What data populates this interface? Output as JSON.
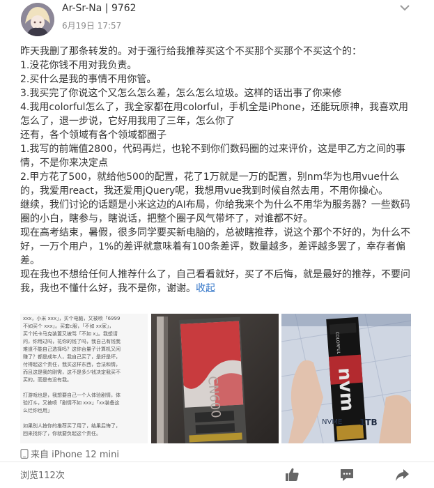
{
  "post": {
    "author": "Ar-Sr-Na | 9762",
    "time": "6月19日 17:57",
    "paragraphs": [
      "昨天我删了那条转发的。对于强行给我推荐买这个不买那个买那个不买这个的：",
      "1.没花你钱不用对我负责。",
      "2.买什么是我的事情不用你管。",
      "3.我买完了你说这个又怎么怎么差，怎么怎么垃圾。这样的话出事了你来修",
      "4.我用colorful怎么了，我全家都在用colorful，手机全是iPhone，还能玩原神，我喜欢用怎么了，退一步说，它好用我用了三年，怎么你了",
      "还有，各个领域有各个领域都圈子",
      "1.我写的前端值2800，代码再烂，也轮不到你们数码圈的过来评价，这是甲乙方之间的事情，不是你来决定点",
      "2.甲方花了500，就给他500的配置，花了1万就是一万的配置，别nm华为也用vue什么的，我爱用react，我还爱用jQuery呢，我想用vue我到时候自然去用，不用你操心。",
      "继续，我们讨论的话题是小米这边的AI布局，你给我来个为什么不用华为服务器？一些数码圈的小白，瞎参与，瞎说话，把整个圈子风气带坏了，对谁都不好。",
      "现在高考结束，暑假，很多同学要买新电脑的，总被瞎推荐，说这个那个不好的，为什么不好，一万个用户，1%的差评就意味着有100条差评，数量越多，差评越多罢了，幸存者偏差。",
      "现在我也不想给任何人推荐什么了，自己看看就好，买了不后悔，就是最好的推荐，不要问我，我也不懂什么好，我不是你，谢谢。"
    ],
    "collapse_label": "收起",
    "source": "来自 iPhone 12 mini",
    "views": "浏览112次"
  },
  "images": {
    "screenshot_lines": [
      "xxx，小米 xxx」，买个电脑，又被喷「6999",
      "不如买个 xxx」。买套c服，「不如 xx家」，",
      "买个托卡马克装置又被骂「不如 x」。我想请",
      "问，你用过吗，花你的钱了吗，我自己有钱我",
      "难道不能自己选择吗？这你台量子计算机又闲",
      "赚了？都是成年人，我自己买了，是好是坏，",
      "付得起这个责任，我买这样东西，合法和情，",
      "而且这是我的刚需，这不是多少钱决定我买不",
      "买的，而是有没有我。",
      "",
      "打游戏也是，我想要自己一个人体验剧情，体",
      "验打斗，又被喷「剧情不如 xxx」「xx装备这",
      "么烂你也用」",
      "",
      "如果别人按你的推荐买了用了，结果后悔了，",
      "回来找你了，你就要负起这个责任。"
    ],
    "ssd_label": "CN600",
    "nvm_brand": "nvm",
    "nvm_maker": "COLORFUL",
    "nvm_type": "NVME",
    "nvm_capacity": "1TB"
  },
  "icons": [
    "chevron-down-icon",
    "phone-icon",
    "thumbs-up-icon",
    "comment-icon",
    "share-icon"
  ]
}
